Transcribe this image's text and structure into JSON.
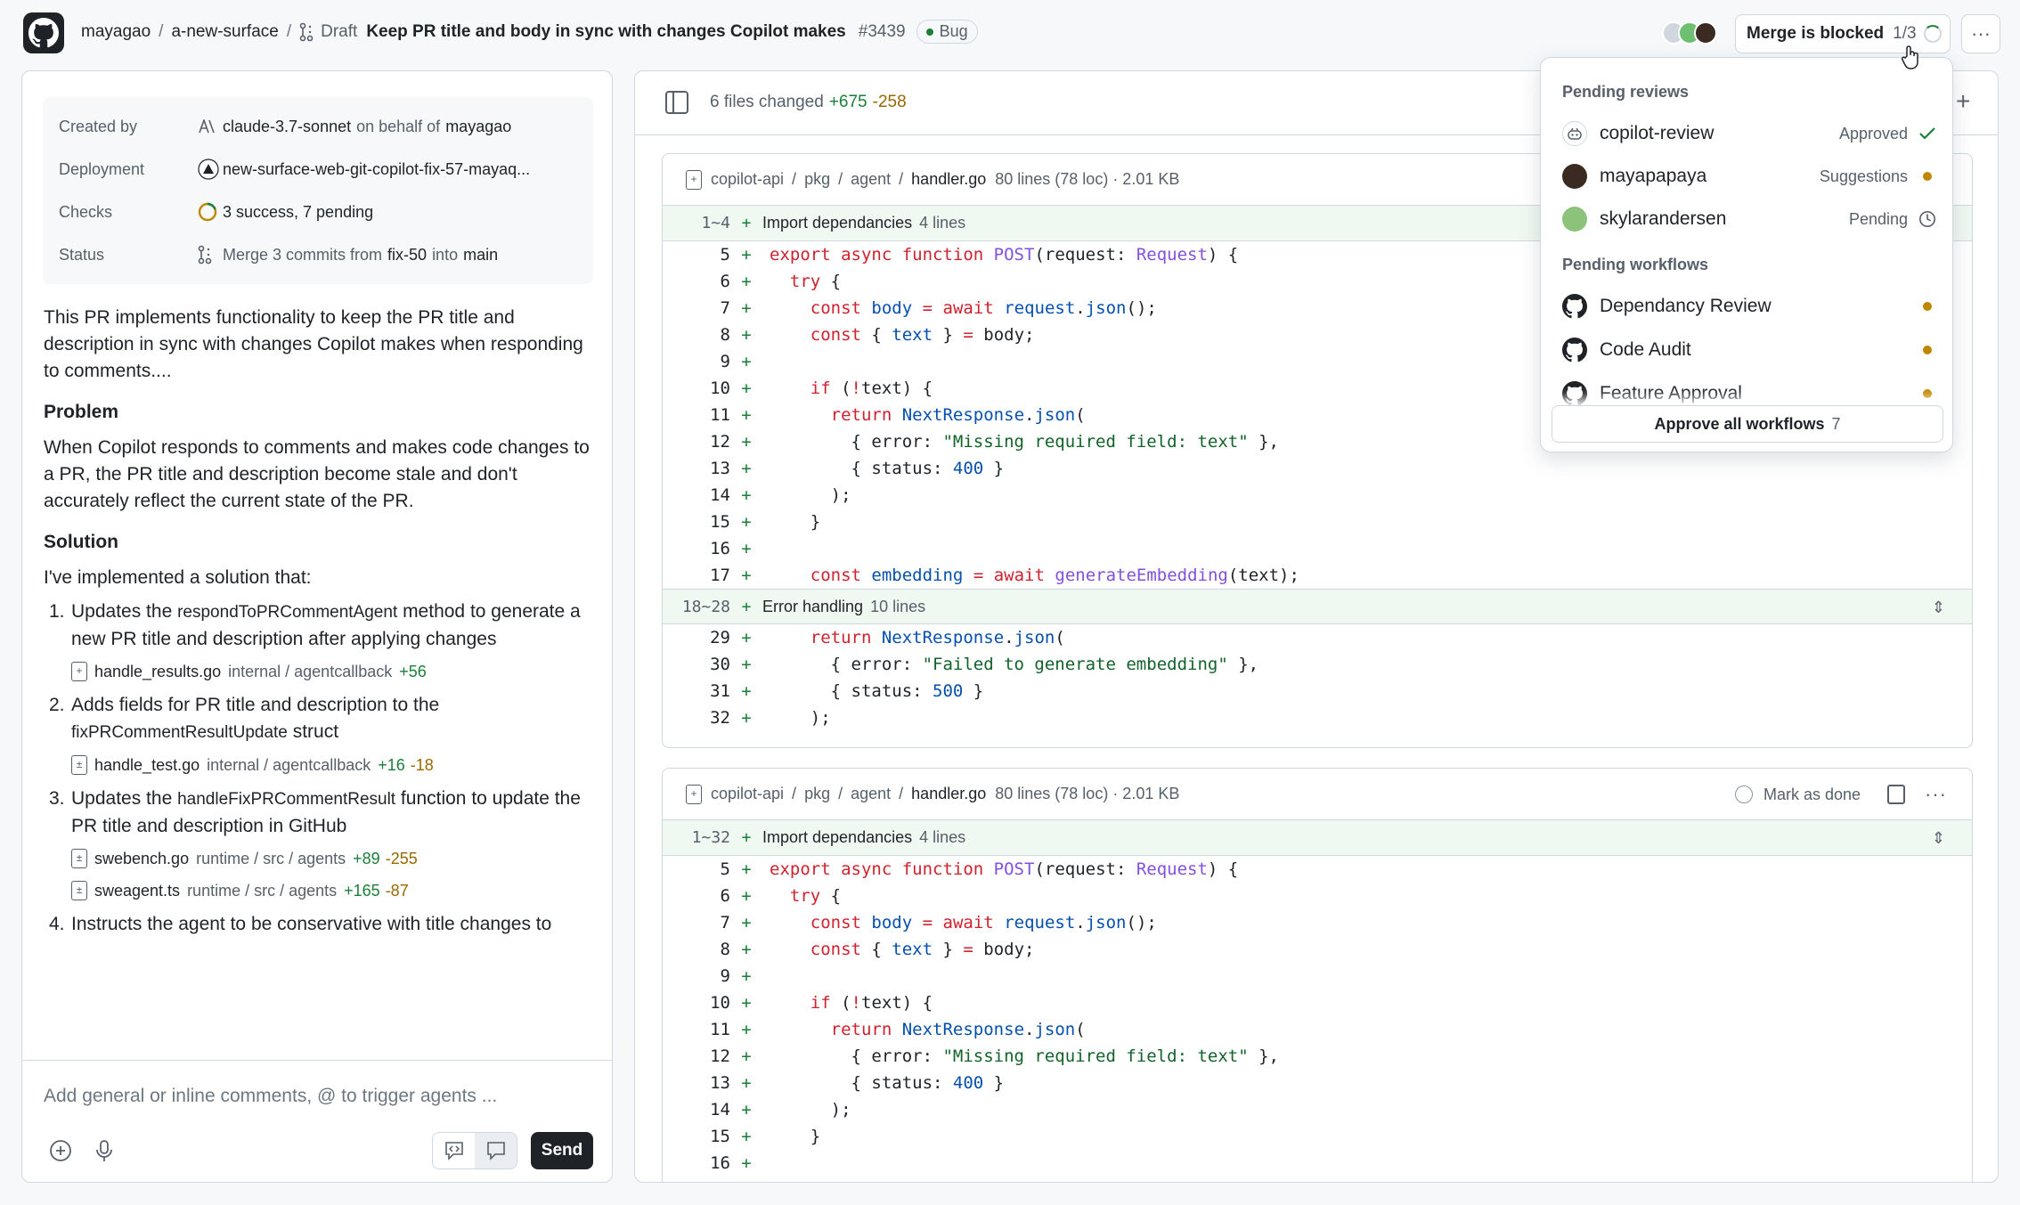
{
  "header": {
    "owner": "mayagao",
    "repo": "a-new-surface",
    "state": "Draft",
    "title": "Keep PR title and body in sync with changes Copilot makes",
    "number": "#3439",
    "label": "Bug",
    "merge_status": "Merge is blocked",
    "merge_count": "1/3"
  },
  "meta": {
    "created_by_key": "Created by",
    "created_by_value": "claude-3.7-sonnet",
    "created_by_middle": "on behalf of",
    "created_by_user": "mayagao",
    "deployment_key": "Deployment",
    "deployment_value": "new-surface-web-git-copilot-fix-57-mayaq...",
    "checks_key": "Checks",
    "checks_value": "3 success, 7 pending",
    "status_key": "Status",
    "status_pre": "Merge 3 commits from",
    "status_branch": "fix-50",
    "status_into": "into",
    "status_base": "main"
  },
  "description": {
    "intro": "This PR implements functionality to keep the PR title and description in sync with changes Copilot makes when responding to comments....",
    "problem_heading": "Problem",
    "problem_text": "When Copilot responds to comments and makes code changes to a PR, the PR title and description become stale and don't accurately reflect the current state of the PR.",
    "solution_heading": "Solution",
    "solution_intro": "I've implemented a solution that:",
    "items": [
      {
        "num": "1.",
        "pre": "Updates the ",
        "code": "respondToPRCommentAgent",
        "post": " method to generate a new PR title and description after applying changes",
        "files": [
          {
            "name": "handle_results.go",
            "path": "internal / agentcallback",
            "add": "+56",
            "del": ""
          }
        ]
      },
      {
        "num": "2.",
        "pre": "Adds fields for PR title and description to the ",
        "code": "fixPRCommentResultUpdate",
        "post": " struct",
        "files": [
          {
            "name": "handle_test.go",
            "path": "internal / agentcallback",
            "add": "+16",
            "del": "-18"
          }
        ]
      },
      {
        "num": "3.",
        "pre": "Updates the ",
        "code": "handleFixPRCommentResult",
        "post": " function to update the PR title and description in GitHub",
        "files": [
          {
            "name": "swebench.go",
            "path": "runtime / src / agents",
            "add": "+89",
            "del": "-255"
          },
          {
            "name": "sweagent.ts",
            "path": "runtime / src / agents",
            "add": "+165",
            "del": "-87"
          }
        ]
      },
      {
        "num": "4.",
        "pre": "Instructs the agent to be conservative with title changes to",
        "code": "",
        "post": "",
        "files": []
      }
    ]
  },
  "composer": {
    "placeholder": "Add general or inline comments, @ to trigger agents ...",
    "send": "Send"
  },
  "diff_header": {
    "files_changed": "6 files changed",
    "additions": "+675",
    "deletions": "-258"
  },
  "files": [
    {
      "path1": "copilot-api",
      "path2": "pkg",
      "path3": "agent",
      "name": "handler.go",
      "meta": "80 lines (78 loc) · 2.01 KB"
    },
    {
      "path1": "copilot-api",
      "path2": "pkg",
      "path3": "agent",
      "name": "handler.go",
      "meta": "80 lines (78 loc) · 2.01 KB",
      "mark_done": "Mark as done"
    }
  ],
  "hunks": {
    "h1_range": "1~4",
    "h1_label": "Import dependancies",
    "h1_count": "4 lines",
    "h2_range": "18~28",
    "h2_label": "Error handling",
    "h2_count": "10 lines",
    "h3_range": "1~32",
    "h3_label": "Import dependancies",
    "h3_count": "4 lines"
  },
  "dropdown": {
    "reviews_heading": "Pending reviews",
    "reviews": [
      {
        "name": "copilot-review",
        "status": "Approved"
      },
      {
        "name": "mayapapaya",
        "status": "Suggestions"
      },
      {
        "name": "skylarandersen",
        "status": "Pending"
      }
    ],
    "workflows_heading": "Pending workflows",
    "workflows": [
      {
        "name": "Dependancy Review"
      },
      {
        "name": "Code Audit"
      },
      {
        "name": "Feature Approval"
      }
    ],
    "approve_all": "Approve all workflows",
    "approve_count": "7"
  }
}
